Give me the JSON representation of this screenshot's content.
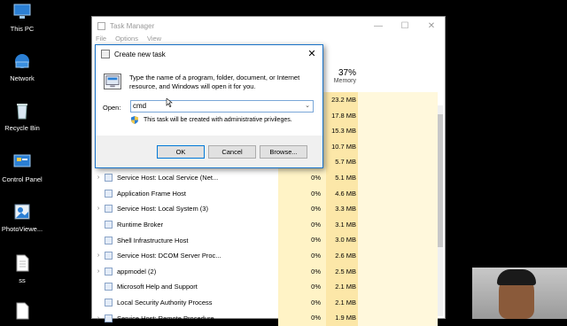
{
  "desktop": {
    "icons": [
      {
        "label": "This PC",
        "icon": "this-pc-icon"
      },
      {
        "label": "Network",
        "icon": "network-icon"
      },
      {
        "label": "Recycle Bin",
        "icon": "recycle-bin-icon"
      },
      {
        "label": "Control Panel",
        "icon": "control-panel-icon"
      },
      {
        "label": "PhotoViewe...",
        "icon": "photo-viewer-icon"
      },
      {
        "label": "ss",
        "icon": "file-icon"
      }
    ]
  },
  "task_manager": {
    "title": "Task Manager",
    "menu": [
      "File",
      "Options",
      "View"
    ],
    "memory_percent": "37%",
    "memory_label": "Memory",
    "rows": [
      {
        "name": "",
        "cpu": "",
        "mem": "23.2 MB",
        "expandable": false
      },
      {
        "name": "",
        "cpu": "",
        "mem": "17.8 MB",
        "expandable": false
      },
      {
        "name": "",
        "cpu": "",
        "mem": "15.3 MB",
        "expandable": false
      },
      {
        "name": "",
        "cpu": "",
        "mem": "10.7 MB",
        "expandable": false
      },
      {
        "name": "",
        "cpu": "",
        "mem": "5.7 MB",
        "expandable": false
      },
      {
        "name": "Service Host: Local Service (Net...",
        "cpu": "0%",
        "mem": "5.1 MB",
        "expandable": true
      },
      {
        "name": "Application Frame Host",
        "cpu": "0%",
        "mem": "4.6 MB",
        "expandable": false
      },
      {
        "name": "Service Host: Local System (3)",
        "cpu": "0%",
        "mem": "3.3 MB",
        "expandable": true
      },
      {
        "name": "Runtime Broker",
        "cpu": "0%",
        "mem": "3.1 MB",
        "expandable": false
      },
      {
        "name": "Shell Infrastructure Host",
        "cpu": "0%",
        "mem": "3.0 MB",
        "expandable": false
      },
      {
        "name": "Service Host: DCOM Server Proc...",
        "cpu": "0%",
        "mem": "2.6 MB",
        "expandable": true
      },
      {
        "name": "appmodel (2)",
        "cpu": "0%",
        "mem": "2.5 MB",
        "expandable": true
      },
      {
        "name": "Microsoft Help and Support",
        "cpu": "0%",
        "mem": "2.1 MB",
        "expandable": false
      },
      {
        "name": "Local Security Authority Process",
        "cpu": "0%",
        "mem": "2.1 MB",
        "expandable": false
      },
      {
        "name": "Service Host: Remote Procedure...",
        "cpu": "0%",
        "mem": "1.9 MB",
        "expandable": true
      }
    ]
  },
  "dialog": {
    "title": "Create new task",
    "description": "Type the name of a program, folder, document, or Internet resource, and Windows will open it for you.",
    "open_label": "Open:",
    "open_value": "cmd",
    "admin_note": "This task will be created with administrative privileges.",
    "ok_label": "OK",
    "cancel_label": "Cancel",
    "browse_label": "Browse..."
  }
}
